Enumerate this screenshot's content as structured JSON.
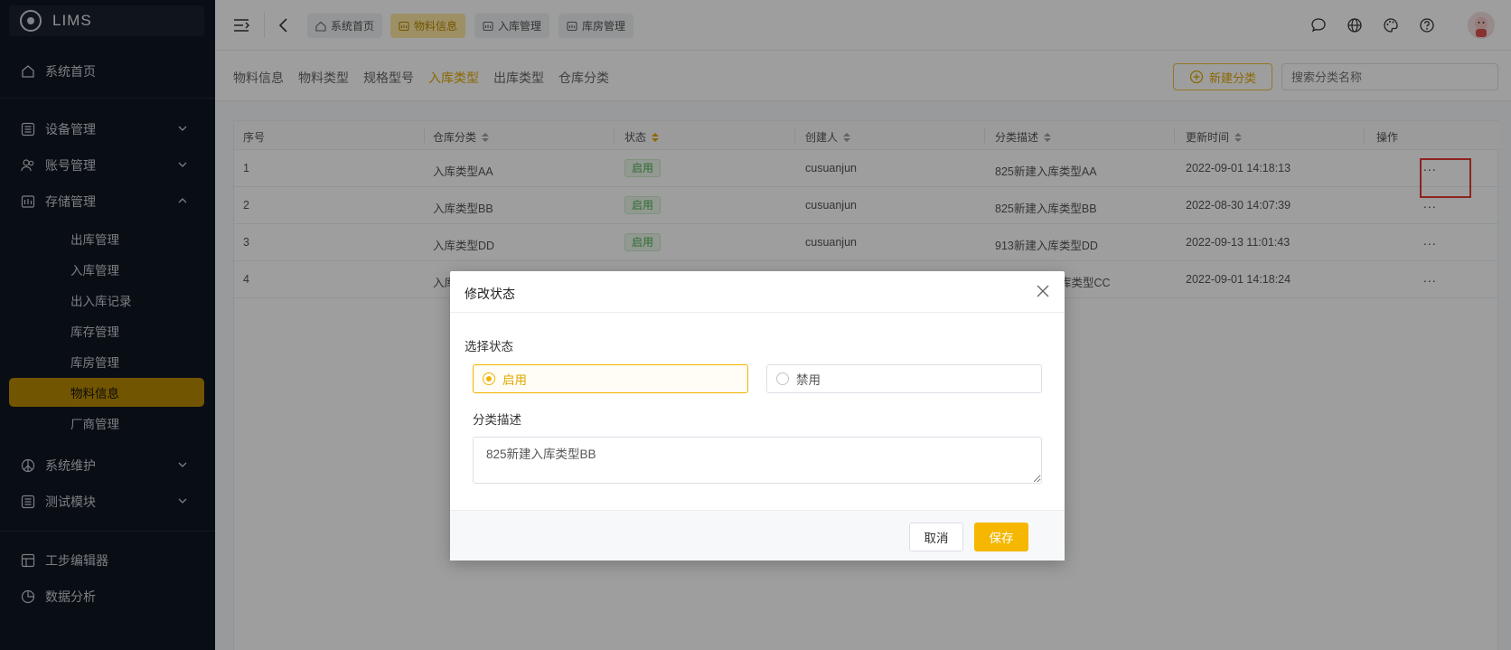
{
  "app": {
    "name": "LIMS"
  },
  "sidebar": {
    "home": "系统首页",
    "groups": [
      {
        "label": "设备管理"
      },
      {
        "label": "账号管理"
      },
      {
        "label": "存储管理"
      }
    ],
    "storage_items": [
      "出库管理",
      "入库管理",
      "出入库记录",
      "库存管理",
      "库房管理",
      "物料信息",
      "厂商管理"
    ],
    "more_groups": [
      {
        "label": "系统维护"
      },
      {
        "label": "测试模块"
      }
    ],
    "bottom_items": [
      "工步编辑器",
      "数据分析"
    ]
  },
  "header": {
    "tags": [
      "系统首页",
      "物料信息",
      "入库管理",
      "库房管理"
    ],
    "active_tag": "物料信息"
  },
  "subtabs": {
    "items": [
      "物料信息",
      "物料类型",
      "规格型号",
      "入库类型",
      "出库类型",
      "仓库分类"
    ],
    "active": "入库类型",
    "new_button": "新建分类",
    "search_placeholder": "搜索分类名称"
  },
  "table": {
    "columns": [
      "序号",
      "仓库分类",
      "状态",
      "创建人",
      "分类描述",
      "更新时间",
      "操作"
    ],
    "rows": [
      {
        "index": "1",
        "category": "入库类型AA",
        "status": "启用",
        "creator": "cusuanjun",
        "desc": "825新建入库类型AA",
        "updated": "2022-09-01 14:18:13",
        "action": "..."
      },
      {
        "index": "2",
        "category": "入库类型BB",
        "status": "启用",
        "creator": "cusuanjun",
        "desc": "825新建入库类型BB",
        "updated": "2022-08-30 14:07:39",
        "action": "..."
      },
      {
        "index": "3",
        "category": "入库类型DD",
        "status": "启用",
        "creator": "cusuanjun",
        "desc": "913新建入库类型DD",
        "updated": "2022-09-13 11:01:43",
        "action": "..."
      },
      {
        "index": "4",
        "category": "入库",
        "status": "",
        "creator": "",
        "desc": "库类型CC",
        "updated": "2022-09-01 14:18:24",
        "action": "..."
      }
    ]
  },
  "modal": {
    "title": "修改状态",
    "status_label": "选择状态",
    "options": [
      "启用",
      "禁用"
    ],
    "selected": "启用",
    "desc_label": "分类描述",
    "desc_value": "825新建入库类型BB",
    "cancel": "取消",
    "save": "保存"
  },
  "colors": {
    "accent": "#f5b700",
    "sidebar_bg": "#0f1521",
    "status_green": "#4caf50",
    "highlight_red": "#e53935"
  }
}
